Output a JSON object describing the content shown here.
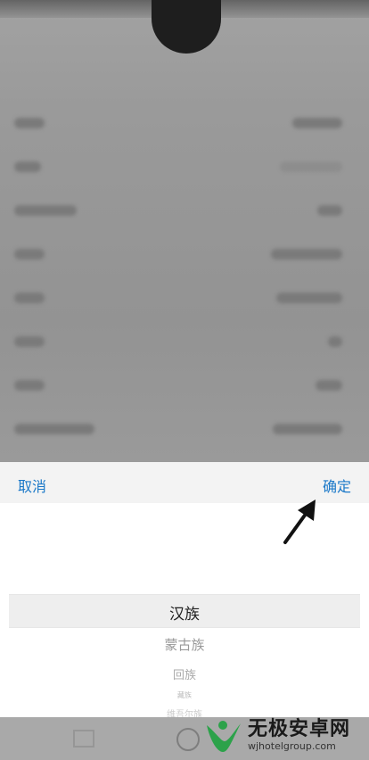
{
  "sheet": {
    "cancel_label": "取消",
    "confirm_label": "确定"
  },
  "picker": {
    "options": [
      "汉族",
      "蒙古族",
      "回族",
      "藏族",
      "维吾尔族"
    ],
    "selected": "汉族"
  },
  "watermark": {
    "title": "无极安卓网",
    "url": "wjhotelgroup.com"
  },
  "colors": {
    "accent": "#1a78c8",
    "overlay": "#9a9a9a",
    "sheet_header": "#f3f3f3",
    "selection_band": "#eeeeee"
  }
}
